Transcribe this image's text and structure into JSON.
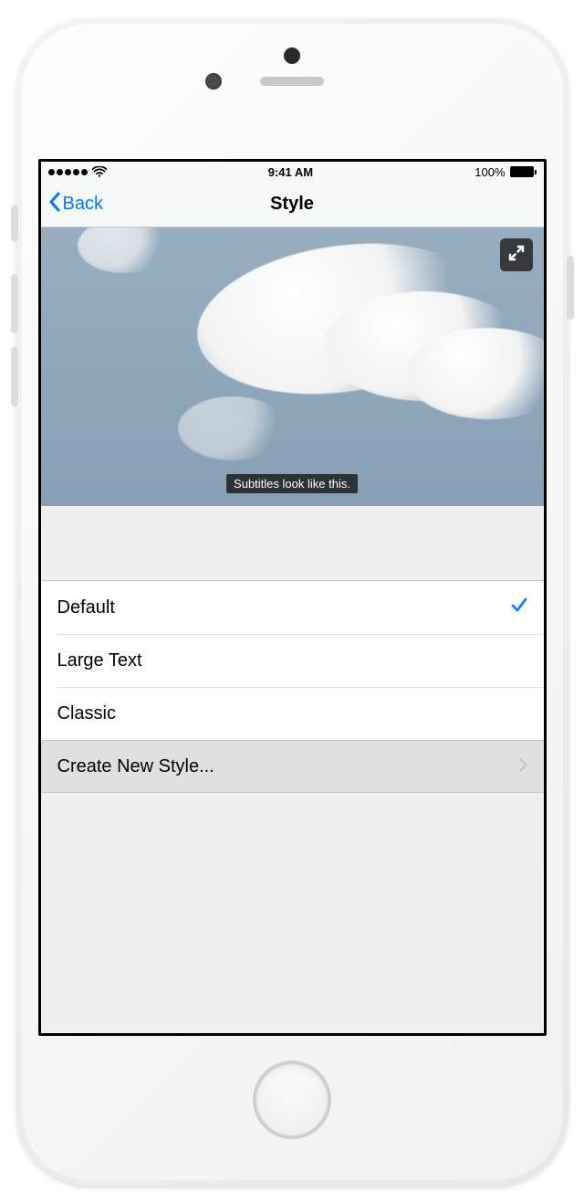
{
  "status": {
    "time": "9:41 AM",
    "battery": "100%"
  },
  "nav": {
    "back_label": "Back",
    "title": "Style"
  },
  "preview": {
    "subtitle_sample": "Subtitles look like this."
  },
  "styles": {
    "items": [
      {
        "label": "Default",
        "selected": true
      },
      {
        "label": "Large Text",
        "selected": false
      },
      {
        "label": "Classic",
        "selected": false
      }
    ],
    "create_label": "Create New Style..."
  },
  "colors": {
    "ios_blue": "#007aff"
  }
}
